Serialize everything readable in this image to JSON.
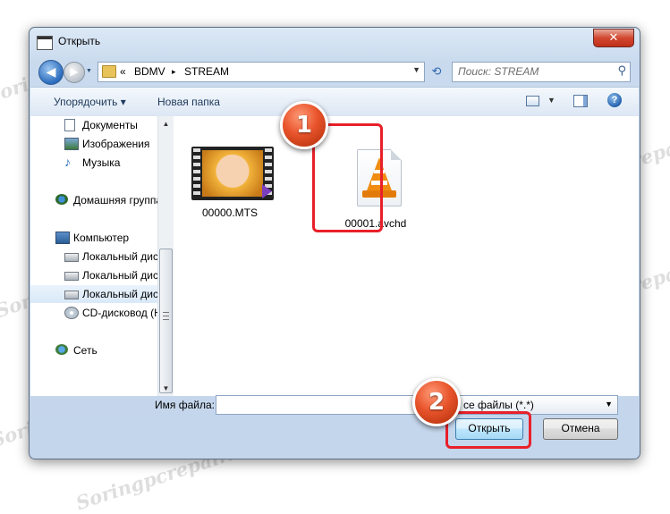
{
  "window": {
    "title": "Открыть",
    "close_glyph": "✕"
  },
  "address_bar": {
    "separator": "«",
    "path": [
      "BDMV",
      "STREAM"
    ],
    "arrow": "▸"
  },
  "search": {
    "placeholder": "Поиск: STREAM"
  },
  "toolbar": {
    "organize_label": "Упорядочить ▾",
    "new_folder_label": "Новая папка",
    "help_glyph": "?"
  },
  "sidebar": {
    "items": [
      {
        "label": "Документы",
        "icon": "documents-icon"
      },
      {
        "label": "Изображения",
        "icon": "pictures-icon"
      },
      {
        "label": "Музыка",
        "icon": "music-icon"
      },
      {
        "label": "Домашняя группа",
        "icon": "homegroup-icon"
      },
      {
        "label": "Компьютер",
        "icon": "computer-icon"
      },
      {
        "label": "Локальный диск",
        "icon": "disk-icon"
      },
      {
        "label": "Локальный диск",
        "icon": "disk-icon"
      },
      {
        "label": "Локальный диск",
        "icon": "disk-icon",
        "selected": true
      },
      {
        "label": "CD-дисковод (H",
        "icon": "cd-icon"
      },
      {
        "label": "Сеть",
        "icon": "network-icon"
      }
    ]
  },
  "files": [
    {
      "name": "00000.MTS",
      "icon": "video-thumbnail"
    },
    {
      "name": "00001.avchd",
      "icon": "vlc-cone-icon"
    }
  ],
  "bottom": {
    "filename_label": "Имя файла:",
    "filename_value": "",
    "filter_value": "се файлы (*.*)",
    "open_label": "Открыть",
    "cancel_label": "Отмена"
  },
  "annotations": {
    "step1": "1",
    "step2": "2",
    "highlight_color": "#e8202a",
    "badge_color": "#e8542b"
  },
  "watermark": "Soringpcrepair.com"
}
